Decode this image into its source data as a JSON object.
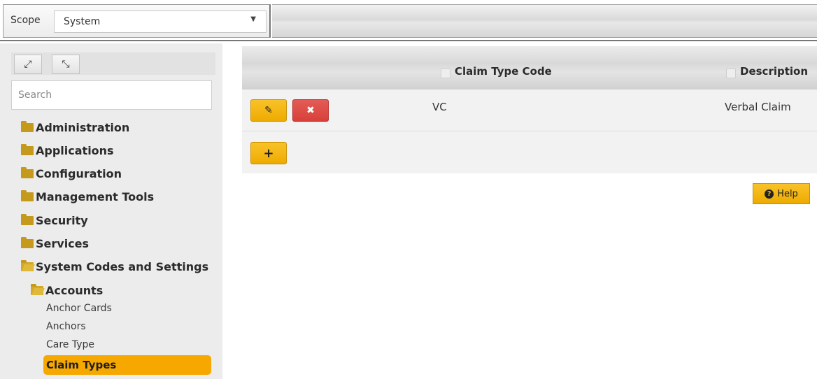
{
  "scope": {
    "label": "Scope",
    "selected": "System"
  },
  "sidebar": {
    "search_placeholder": "Search",
    "tree": [
      {
        "label": "Administration"
      },
      {
        "label": "Applications"
      },
      {
        "label": "Configuration"
      },
      {
        "label": "Management Tools"
      },
      {
        "label": "Security"
      },
      {
        "label": "Services"
      },
      {
        "label": "System Codes and Settings"
      }
    ],
    "subfolder": {
      "label": "Accounts"
    },
    "leaves": [
      {
        "label": "Anchor Cards"
      },
      {
        "label": "Anchors"
      },
      {
        "label": "Care Type"
      },
      {
        "label": "Claim Types",
        "selected": true
      }
    ]
  },
  "grid": {
    "columns": [
      "Claim Type Code",
      "Description"
    ],
    "rows": [
      {
        "code": "VC",
        "description": "Verbal Claim"
      }
    ]
  },
  "help": {
    "label": "Help"
  },
  "colors": {
    "accent": "#f4b400",
    "delete": "#d9443e",
    "selected_bg": "#f7a800"
  },
  "icons": {
    "expand": "expand-all-icon",
    "collapse": "collapse-all-icon",
    "edit": "edit-icon",
    "delete": "delete-icon",
    "add": "plus-icon",
    "help": "question-circle-icon"
  }
}
